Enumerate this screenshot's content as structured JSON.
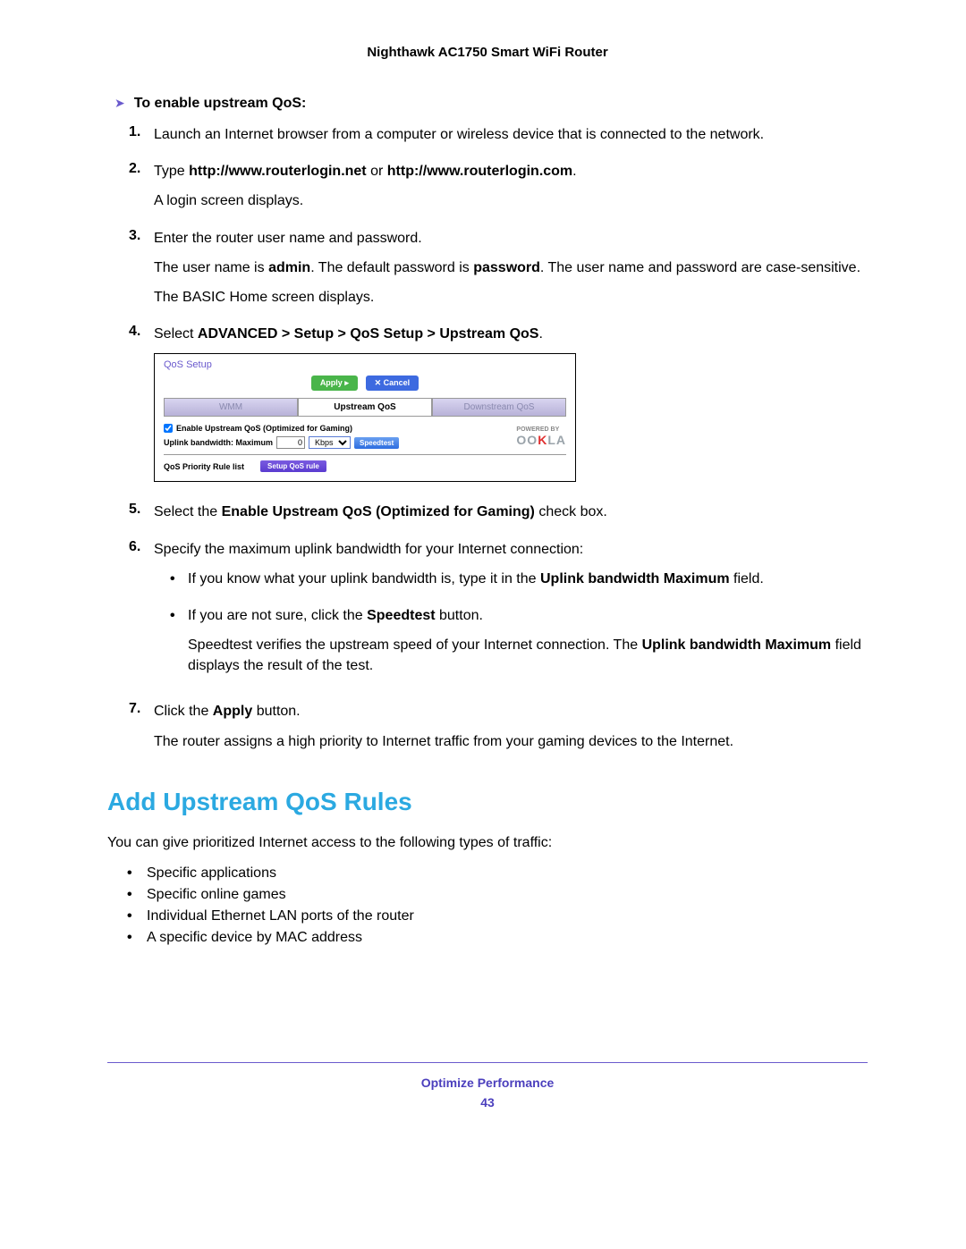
{
  "header": "Nighthawk AC1750 Smart WiFi Router",
  "arrow_heading": "To enable upstream QoS:",
  "steps": {
    "s1": {
      "num": "1.",
      "text": "Launch an Internet browser from a computer or wireless device that is connected to the network."
    },
    "s2": {
      "num": "2.",
      "pre": "Type ",
      "b1": "http://www.routerlogin.net",
      "mid": " or ",
      "b2": "http://www.routerlogin.com",
      "post": ".",
      "after": "A login screen displays."
    },
    "s3": {
      "num": "3.",
      "text": "Enter the router user name and password.",
      "line2a": "The user name is ",
      "line2b": "admin",
      "line2c": ". The default password is ",
      "line2d": "password",
      "line2e": ". The user name and password are case-sensitive.",
      "line3": "The BASIC Home screen displays."
    },
    "s4": {
      "num": "4.",
      "pre": "Select ",
      "b": "ADVANCED > Setup > QoS Setup > Upstream QoS",
      "post": "."
    },
    "s5": {
      "num": "5.",
      "pre": "Select the ",
      "b": "Enable Upstream QoS (Optimized for Gaming)",
      "post": " check box."
    },
    "s6": {
      "num": "6.",
      "text": "Specify the maximum uplink bandwidth for your Internet connection:",
      "bullet1a": "If you know what your uplink bandwidth is, type it in the ",
      "bullet1b": "Uplink bandwidth Maximum",
      "bullet1c": " field.",
      "bullet2a": "If you are not sure, click the ",
      "bullet2b": "Speedtest",
      "bullet2c": " button.",
      "bullet2_p2a": "Speedtest verifies the upstream speed of your Internet connection. The ",
      "bullet2_p2b": "Uplink bandwidth Maximum",
      "bullet2_p2c": " field displays the result of the test."
    },
    "s7": {
      "num": "7.",
      "pre": "Click the ",
      "b": "Apply",
      "post": " button.",
      "after": "The router assigns a high priority to Internet traffic from your gaming devices to the Internet."
    }
  },
  "panel": {
    "title": "QoS Setup",
    "apply": "Apply ▸",
    "cancel": "✕ Cancel",
    "tab_wmm": "WMM",
    "tab_upstream": "Upstream QoS",
    "tab_downstream": "Downstream QoS",
    "checkbox_label": "Enable Upstream QoS (Optimized for Gaming)",
    "uplink_label": "Uplink bandwidth: Maximum",
    "uplink_value": "0",
    "unit": "Kbps",
    "speedtest": "Speedtest",
    "powered": "POWERED BY",
    "ookla": "OOKLA",
    "rule_label": "QoS Priority Rule list",
    "setup_rule": "Setup QoS rule"
  },
  "section_title": "Add Upstream QoS Rules",
  "section_intro": "You can give prioritized Internet access to the following types of traffic:",
  "traffic": {
    "t1": "Specific applications",
    "t2": "Specific online games",
    "t3": "Individual Ethernet LAN ports of the router",
    "t4": "A specific device by MAC address"
  },
  "footer_text": "Optimize Performance",
  "footer_page": "43"
}
